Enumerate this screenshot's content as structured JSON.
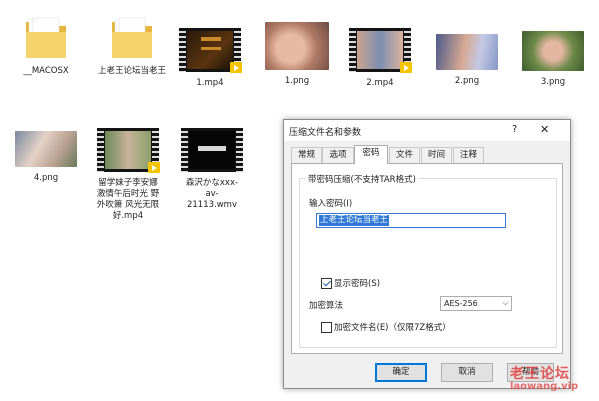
{
  "files": [
    {
      "name": "__MACOSX",
      "kind": "folder"
    },
    {
      "name": "上老王论坛当老王",
      "kind": "folder"
    },
    {
      "name": "1.mp4",
      "kind": "video"
    },
    {
      "name": "1.png",
      "kind": "image"
    },
    {
      "name": "2.mp4",
      "kind": "video"
    },
    {
      "name": "2.png",
      "kind": "image"
    },
    {
      "name": "3.png",
      "kind": "image"
    },
    {
      "name": "4.png",
      "kind": "image"
    },
    {
      "name": "留学妹子李安娜激情午后时光 野外吹箫 风光无限好.mp4",
      "kind": "video"
    },
    {
      "name": "森沢かなxxx-av-21113.wmv",
      "kind": "video"
    }
  ],
  "dialog": {
    "title": "压缩文件名和参数",
    "help_label": "?",
    "close_label": "✕",
    "tabs": [
      "常规",
      "选项",
      "密码",
      "文件",
      "时间",
      "注释"
    ],
    "active_tab": "密码",
    "group_label": "带密码压缩(不支持TAR格式)",
    "password_label": "输入密码(I)",
    "password_value": "上老王论坛当老王",
    "show_password_label": "显示密码(S)",
    "show_password_checked": true,
    "algorithm_label": "加密算法",
    "algorithm_value": "AES-256",
    "encrypt_names_label": "加密文件名(E)（仅限7Z格式）",
    "encrypt_names_checked": false,
    "buttons": {
      "ok": "确定",
      "cancel": "取消",
      "help": "帮助"
    }
  },
  "watermark": {
    "line1": "老王论坛",
    "line2": "laowang.vip"
  },
  "colors": {
    "accent": "#0078d7",
    "selection": "#3079d6",
    "folder": "#f2c94c"
  }
}
